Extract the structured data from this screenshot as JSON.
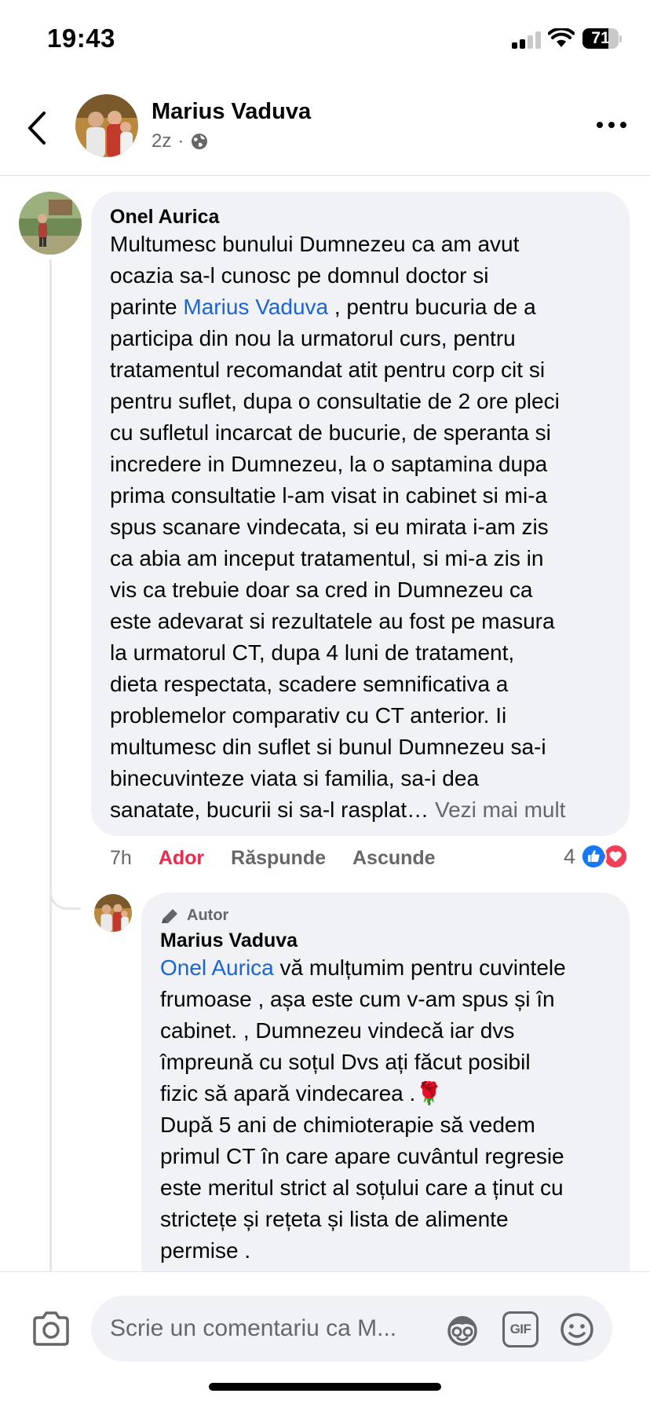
{
  "status_bar": {
    "time": "19:43",
    "battery_level": "71"
  },
  "header": {
    "name": "Marius Vaduva",
    "time_ago": "2z",
    "separator": "·",
    "back_icon": "chevron-left-icon",
    "privacy_icon": "globe-icon",
    "more_icon": "more-horizontal-icon"
  },
  "comment": {
    "author": "Onel Aurica",
    "lines": [
      {
        "parts": [
          {
            "t": "Multumesc bunului Dumnezeu ca am avut"
          }
        ]
      },
      {
        "parts": [
          {
            "t": "ocazia sa-l cunosc pe domnul doctor si"
          }
        ]
      },
      {
        "parts": [
          {
            "t": "parinte "
          },
          {
            "t": "Marius Vaduva",
            "mention": true
          },
          {
            "t": " , pentru bucuria de a"
          }
        ]
      },
      {
        "parts": [
          {
            "t": "participa din nou la urmatorul curs, pentru"
          }
        ]
      },
      {
        "parts": [
          {
            "t": "tratamentul recomandat atit pentru corp cit si"
          }
        ]
      },
      {
        "parts": [
          {
            "t": "pentru suflet, dupa o consultatie de 2 ore pleci"
          }
        ]
      },
      {
        "parts": [
          {
            "t": "cu sufletul incarcat de bucurie, de speranta si"
          }
        ]
      },
      {
        "parts": [
          {
            "t": "incredere in Dumnezeu, la o saptamina dupa"
          }
        ]
      },
      {
        "parts": [
          {
            "t": "prima consultatie l-am visat in cabinet si mi-a"
          }
        ]
      },
      {
        "parts": [
          {
            "t": "spus scanare vindecata, si eu mirata i-am zis"
          }
        ]
      },
      {
        "parts": [
          {
            "t": "ca abia am inceput tratamentul, si mi-a zis in"
          }
        ]
      },
      {
        "parts": [
          {
            "t": "vis ca trebuie doar sa cred in Dumnezeu ca"
          }
        ]
      },
      {
        "parts": [
          {
            "t": "este adevarat si rezultatele au fost pe masura"
          }
        ]
      },
      {
        "parts": [
          {
            "t": "la urmatorul CT, dupa 4 luni de tratament,"
          }
        ]
      },
      {
        "parts": [
          {
            "t": "dieta respectata, scadere semnificativa a"
          }
        ]
      },
      {
        "parts": [
          {
            "t": "problemelor comparativ cu CT anterior. Ii"
          }
        ]
      },
      {
        "parts": [
          {
            "t": "multumesc din suflet si bunul Dumnezeu sa-i"
          }
        ]
      },
      {
        "parts": [
          {
            "t": "binecuvinteze viata si familia, sa-i dea"
          }
        ]
      },
      {
        "parts": [
          {
            "t": "sanatate, bucurii si sa-l rasplat… "
          },
          {
            "t": "Vezi mai mult",
            "see_more": true
          }
        ]
      }
    ],
    "time_ago": "7h",
    "reaction_label": "Ador",
    "reply_label": "Răspunde",
    "hide_label": "Ascunde",
    "reaction_count": "4",
    "reaction_icons": [
      "like-icon",
      "love-icon"
    ]
  },
  "reply": {
    "badge": "Autor",
    "badge_icon": "pencil-icon",
    "author": "Marius Vaduva",
    "lines": [
      {
        "parts": [
          {
            "t": "Onel Aurica",
            "mention": true
          },
          {
            "t": " vă mulțumim pentru cuvintele"
          }
        ]
      },
      {
        "parts": [
          {
            "t": "frumoase , așa este cum v-am spus și în"
          }
        ]
      },
      {
        "parts": [
          {
            "t": "cabinet. , Dumnezeu vindecă iar dvs"
          }
        ]
      },
      {
        "parts": [
          {
            "t": "împreună cu soțul Dvs ați făcut posibil"
          }
        ]
      },
      {
        "parts": [
          {
            "t": "fizic să apară vindecarea .🌹"
          }
        ]
      },
      {
        "parts": [
          {
            "t": "După 5 ani de chimioterapie să vedem"
          }
        ]
      },
      {
        "parts": [
          {
            "t": "primul CT în care apare cuvântul regresie"
          }
        ]
      },
      {
        "parts": [
          {
            "t": "este meritul strict al soțului care a ținut cu"
          }
        ]
      },
      {
        "parts": [
          {
            "t": "strictețe și rețeta și lista de alimente"
          }
        ]
      },
      {
        "parts": [
          {
            "t": "permise ."
          }
        ]
      }
    ]
  },
  "composer": {
    "placeholder": "Scrie un comentariu ca M...",
    "camera_icon": "camera-icon",
    "avatar_icon": "avatar-sticker-icon",
    "gif_label": "GIF",
    "emoji_icon": "emoji-icon"
  },
  "colors": {
    "mention": "#1b64d6",
    "love": "#f0284a",
    "bubble": "#f0f2f5",
    "secondary_text": "#65676b"
  }
}
